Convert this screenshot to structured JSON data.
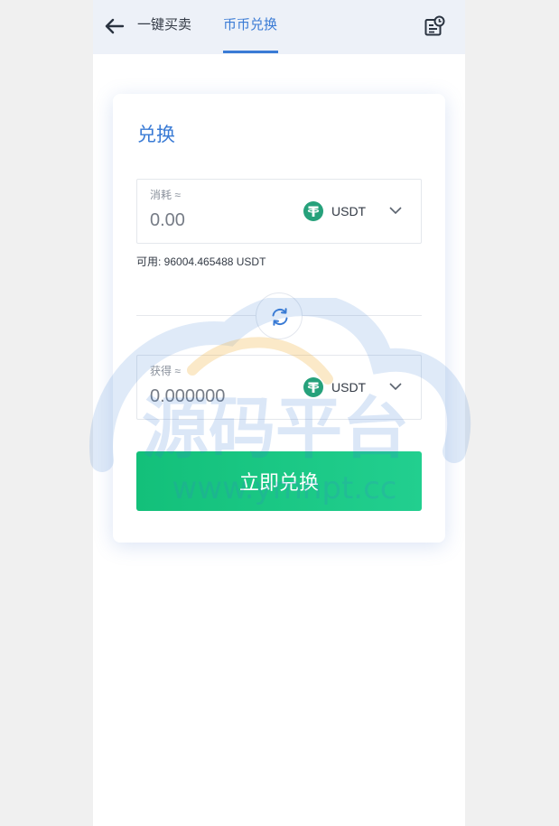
{
  "header": {
    "tabs": [
      {
        "label": "一键买卖",
        "active": false
      },
      {
        "label": "币币兑换",
        "active": true
      }
    ]
  },
  "card": {
    "title": "兑换",
    "pay": {
      "label": "消耗 ≈",
      "amount": "0.00",
      "coin": "USDT",
      "coin_icon": "tether-icon"
    },
    "available": "可用: 96004.465488 USDT",
    "get": {
      "label": "获得 ≈",
      "amount": "0.000000",
      "coin": "USDT",
      "coin_icon": "tether-icon"
    },
    "submit_label": "立即兑换"
  },
  "watermark": {
    "title": "源码平台",
    "url": "www.ymnpt.cc"
  },
  "colors": {
    "accent": "#3a7bd5",
    "header_bg": "#edf1f8",
    "tether": "#26a17b",
    "button_start": "#13c07a",
    "button_end": "#22cf8f"
  }
}
